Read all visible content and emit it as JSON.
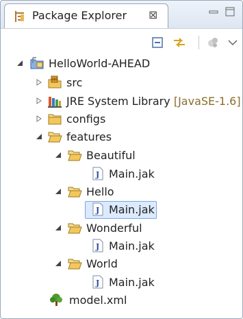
{
  "view": {
    "tab_title": "Package Explorer",
    "tab_icon": "package-explorer-icon",
    "close_glyph": "⊠"
  },
  "toolbar": {
    "buttons": [
      "collapse-all-icon",
      "link-with-editor-icon",
      "focus-task-icon",
      "view-menu-icon"
    ]
  },
  "tree": {
    "project": {
      "label": "HelloWorld-AHEAD",
      "icon": "java-project-icon",
      "expanded": true
    },
    "src": {
      "label": "src",
      "icon": "source-folder-icon",
      "expanded": false
    },
    "jre": {
      "label": "JRE System Library",
      "decoration": "[JavaSE-1.6]",
      "icon": "library-icon",
      "expanded": false
    },
    "configs": {
      "label": "configs",
      "icon": "folder-icon",
      "expanded": false
    },
    "features": {
      "label": "features",
      "icon": "folder-icon",
      "expanded": true
    },
    "beautiful": {
      "label": "Beautiful",
      "icon": "folder-icon",
      "expanded": true
    },
    "beautiful_main": {
      "label": "Main.jak",
      "icon": "jak-file-icon"
    },
    "hello": {
      "label": "Hello",
      "icon": "folder-icon",
      "expanded": true
    },
    "hello_main": {
      "label": "Main.jak",
      "icon": "jak-file-icon",
      "selected": true
    },
    "wonderful": {
      "label": "Wonderful",
      "icon": "folder-icon",
      "expanded": true
    },
    "wonderful_main": {
      "label": "Main.jak",
      "icon": "jak-file-icon"
    },
    "world": {
      "label": "World",
      "icon": "folder-icon",
      "expanded": true
    },
    "world_main": {
      "label": "Main.jak",
      "icon": "jak-file-icon"
    },
    "model": {
      "label": "model.xml",
      "icon": "feature-model-tree-icon"
    }
  },
  "colors": {
    "selection": "#dceafd",
    "selection_border": "#7aa7e0",
    "folder": "#f2c75c",
    "decoration": "#8a6d2d"
  }
}
